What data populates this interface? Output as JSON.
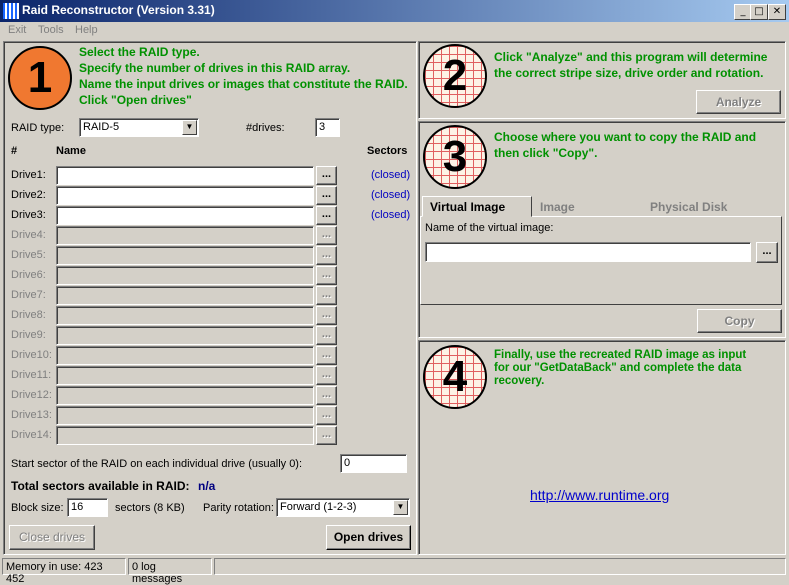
{
  "window": {
    "title": "Raid Reconstructor (Version 3.31)",
    "minimize": "_",
    "maximize": "□",
    "close": "✕"
  },
  "menu": {
    "exit": "Exit",
    "tools": "Tools",
    "help": "Help"
  },
  "step1": {
    "number": "1",
    "lines": [
      "Select the RAID type.",
      "Specify the number of drives in this RAID array.",
      "Name the input drives or images that constitute the RAID.",
      "Click \"Open drives\""
    ],
    "raid_type_label": "RAID type:",
    "raid_type_value": "RAID-5",
    "drives_label": "#drives:",
    "drives_value": "3",
    "col_num": "#",
    "col_name": "Name",
    "col_sectors": "Sectors",
    "browse_label": "...",
    "drives": [
      {
        "label": "Drive1:",
        "status": "(closed)"
      },
      {
        "label": "Drive2:",
        "status": "(closed)"
      },
      {
        "label": "Drive3:",
        "status": "(closed)"
      },
      {
        "label": "Drive4:"
      },
      {
        "label": "Drive5:"
      },
      {
        "label": "Drive6:"
      },
      {
        "label": "Drive7:"
      },
      {
        "label": "Drive8:"
      },
      {
        "label": "Drive9:"
      },
      {
        "label": "Drive10:"
      },
      {
        "label": "Drive11:"
      },
      {
        "label": "Drive12:"
      },
      {
        "label": "Drive13:"
      },
      {
        "label": "Drive14:"
      }
    ],
    "start_sector_label": "Start sector of the RAID on each individual drive (usually 0):",
    "start_sector_value": "0",
    "total_label": "Total sectors available in RAID:",
    "total_value": "n/a",
    "block_size_label": "Block size:",
    "block_size_value": "16",
    "block_size_unit": "sectors (8 KB)",
    "parity_label": "Parity rotation:",
    "parity_value": "Forward (1-2-3)",
    "close_drives": "Close drives",
    "open_drives": "Open drives"
  },
  "step2": {
    "number": "2",
    "lines": [
      "Click \"Analyze\" and this program will determine",
      "the correct stripe size, drive order and rotation."
    ],
    "analyze": "Analyze"
  },
  "step3": {
    "number": "3",
    "lines": [
      "Choose where you want to copy the RAID and",
      "then click \"Copy\"."
    ],
    "tabs": [
      "Virtual Image",
      "Image",
      "Physical Disk"
    ],
    "name_label": "Name of the virtual image:",
    "name_value": "",
    "browse_label": "...",
    "copy": "Copy"
  },
  "step4": {
    "number": "4",
    "lines": [
      "Finally, use the recreated RAID image as input",
      "for our \"GetDataBack\" and complete the data",
      "recovery."
    ],
    "link": "http://www.runtime.org"
  },
  "status": {
    "memory": "Memory in use: 423 452",
    "log": "0 log messages"
  },
  "colors": {
    "accent_orange": "#f07830",
    "step_text": "#009100",
    "link": "#0000cc"
  }
}
